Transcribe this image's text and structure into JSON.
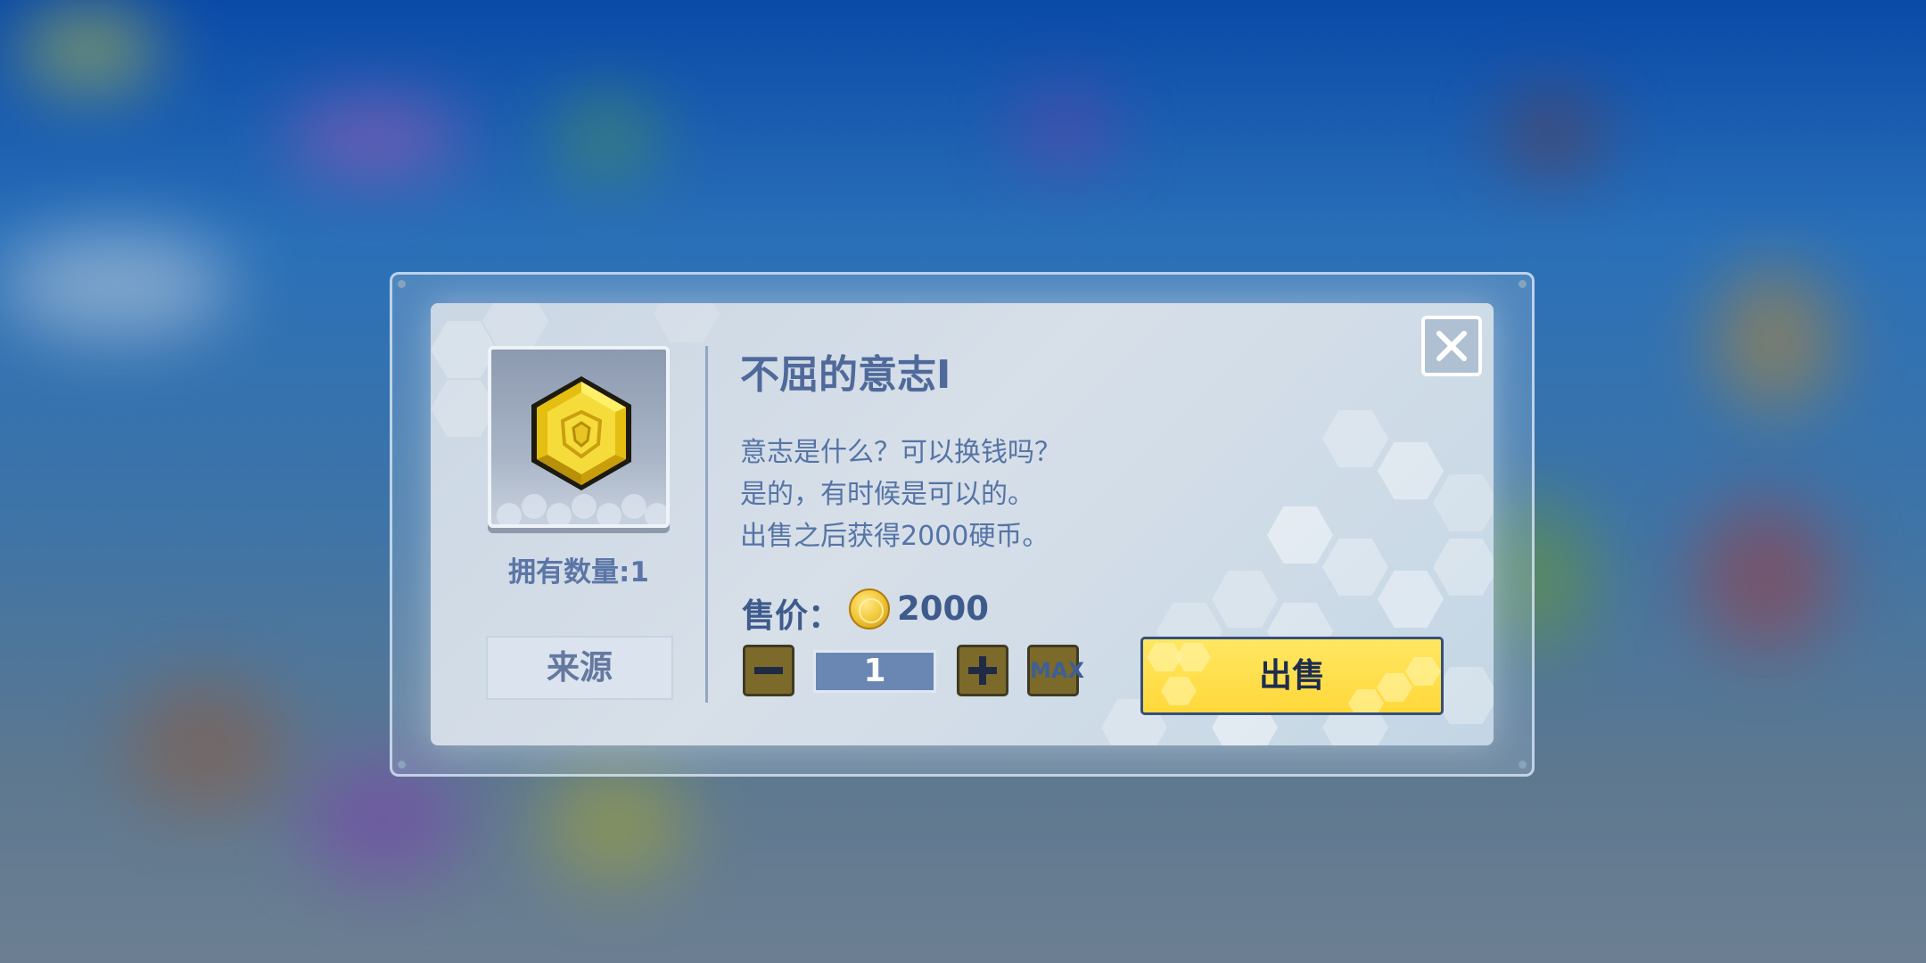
{
  "dialog": {
    "title": "不屈的意志Ⅰ",
    "description": [
      "意志是什么？可以换钱吗？",
      "是的，有时候是可以的。",
      "出售之后获得2000硬币。"
    ],
    "owned_count": "拥有数量:1",
    "source_button": "来源",
    "price_label": "售价：",
    "price_value": "2000",
    "quantity": "1",
    "max_label": "MAX",
    "sell_button": "出售",
    "icons": {
      "item": "gold-hexagon-medal-icon",
      "currency": "gold-coin-icon",
      "close": "close-icon",
      "minus": "minus-icon",
      "plus": "plus-icon"
    }
  },
  "colors": {
    "sell_button": "#ffe05a",
    "title_text": "#4f6a9a",
    "qty_button": "#7c6a2a"
  }
}
